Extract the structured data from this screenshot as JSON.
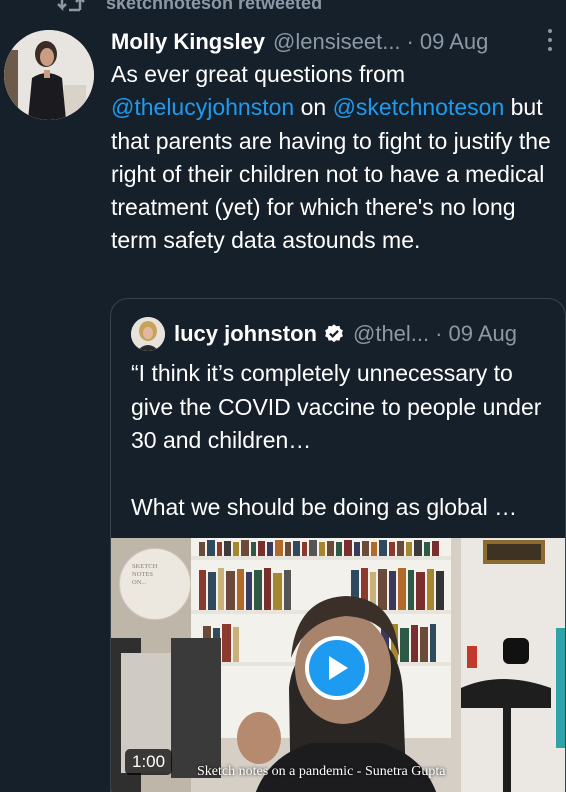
{
  "retweet": {
    "label": "sketchnoteson retweeted"
  },
  "tweet": {
    "name": "Molly Kingsley",
    "handle": "@lensiseet...",
    "dot": "·",
    "date": "09 Aug",
    "text_part1": "As ever great questions from",
    "mention1": "@thelucyjohnston",
    "text_on": "on",
    "mention2": "@sketchnoteson",
    "text_part2": "but that parents are having to fight to justify the right of their children not to have a medical treatment (yet) for which there's no long term safety data astounds me."
  },
  "quote": {
    "name": "lucy johnston",
    "handle": "@thel...",
    "dot": "·",
    "date": "09 Aug",
    "text": "“I think it’s completely unnecessary to give the COVID vaccine to people under 30 and children…\n\nWhat we should be doing as global …",
    "media": {
      "duration": "1:00",
      "caption": "Sketch notes on a pandemic - Sunetra Gupta",
      "badge_line1": "SKETCH",
      "badge_line2": "NOTES",
      "badge_line3": "ON..."
    }
  },
  "colors": {
    "background": "#15202b",
    "accent": "#1d9bf0",
    "secondary_text": "#8b98a5",
    "border": "#38444d"
  },
  "icons": [
    "retweet-icon",
    "more-options-icon",
    "verified-badge-icon",
    "play-icon"
  ]
}
